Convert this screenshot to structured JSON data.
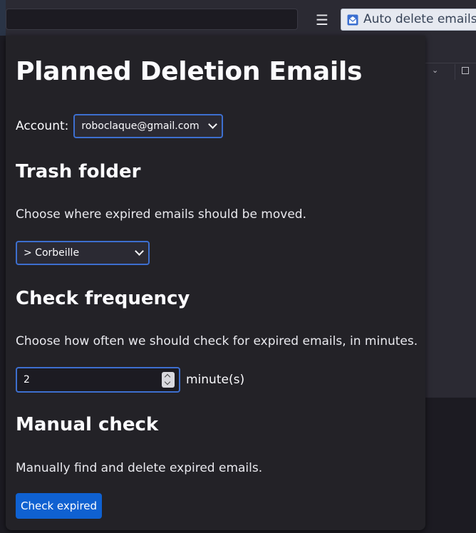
{
  "browser": {
    "menu_icon": "hamburger-menu-icon",
    "extension_tab": {
      "icon": "envelope-icon",
      "label": "Auto delete emails"
    }
  },
  "popup": {
    "title": "Planned Deletion Emails",
    "account": {
      "label": "Account:",
      "selected": "roboclaque@gmail.com"
    },
    "trash_folder": {
      "heading": "Trash folder",
      "description": "Choose where expired emails should be moved.",
      "selected": "> Corbeille"
    },
    "check_frequency": {
      "heading": "Check frequency",
      "description": "Choose how often we should check for expired emails, in minutes.",
      "value": "2",
      "unit": "minute(s)"
    },
    "manual_check": {
      "heading": "Manual check",
      "description": "Manually find and delete expired emails.",
      "button_label": "Check expired"
    }
  },
  "colors": {
    "accent": "#3d6fcf",
    "button": "#0f61d1",
    "popup_bg": "#232227"
  }
}
